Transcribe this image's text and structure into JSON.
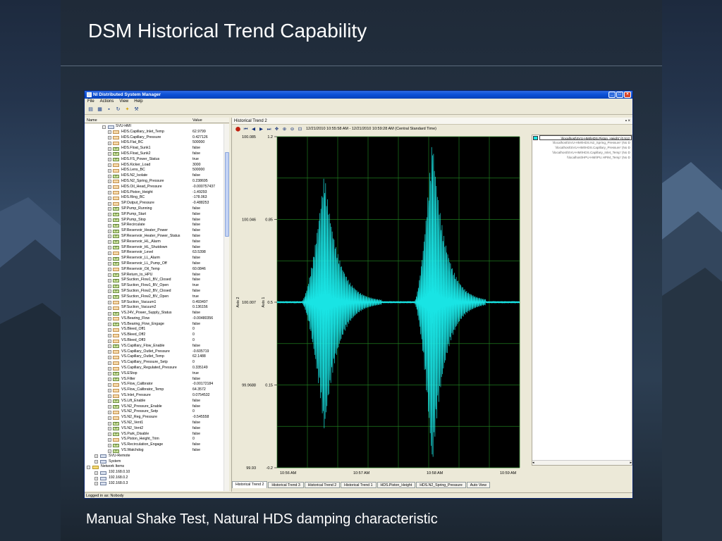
{
  "slide": {
    "title": "DSM Historical Trend Capability",
    "caption": "Manual Shake Test, Natural HDS damping characteristic"
  },
  "window": {
    "title": "NI Distributed System Manager",
    "menu": [
      "File",
      "Actions",
      "View",
      "Help"
    ],
    "toolbar_icons": [
      "new-icon",
      "open-icon",
      "save-icon",
      "refresh-icon",
      "star-icon",
      "wrench-icon"
    ],
    "columns": {
      "name": "Name",
      "value": "Value"
    },
    "status": "Logged in as: Nobody"
  },
  "tree": {
    "root": "SVU-HMI",
    "items": [
      {
        "name": "HDS.Capillary_Inlet_Temp",
        "value": "62.9799",
        "type": "num"
      },
      {
        "name": "HDS.Capillary_Pressure",
        "value": "0.427126",
        "type": "num"
      },
      {
        "name": "HDS.Flat_BC",
        "value": "500000",
        "type": "num"
      },
      {
        "name": "HDS.Float_Sunk1",
        "value": "false",
        "type": "bool"
      },
      {
        "name": "HDS.Float_Sunk2",
        "value": "false",
        "type": "bool"
      },
      {
        "name": "HDS.FS_Power_Status",
        "value": "true",
        "type": "bool"
      },
      {
        "name": "HDS.Kicker_Load",
        "value": "3000",
        "type": "num"
      },
      {
        "name": "HDS.Lens_BC",
        "value": "500000",
        "type": "num"
      },
      {
        "name": "HDS.N2_Isolate",
        "value": "false",
        "type": "bool"
      },
      {
        "name": "HDS.N2_Spring_Pressure",
        "value": "0.238695",
        "type": "num"
      },
      {
        "name": "HDS.Oil_Head_Pressure",
        "value": "-0.000757437",
        "type": "num"
      },
      {
        "name": "HDS.Piston_Height",
        "value": "-1.49293",
        "type": "num"
      },
      {
        "name": "HDS.Ring_BC",
        "value": "-178.063",
        "type": "num"
      },
      {
        "name": "SP.Output_Pressure",
        "value": "-0.488253",
        "type": "num"
      },
      {
        "name": "SP.Pump_Running",
        "value": "false",
        "type": "bool"
      },
      {
        "name": "SP.Pump_Start",
        "value": "false",
        "type": "bool"
      },
      {
        "name": "SP.Pump_Stop",
        "value": "false",
        "type": "bool"
      },
      {
        "name": "SP.Recirculate",
        "value": "false",
        "type": "bool"
      },
      {
        "name": "SP.Reservoir_Heater_Power",
        "value": "false",
        "type": "bool"
      },
      {
        "name": "SP.Reservoir_Heater_Power_Status",
        "value": "false",
        "type": "bool"
      },
      {
        "name": "SP.Reservoir_HL_Alarm",
        "value": "false",
        "type": "bool"
      },
      {
        "name": "SP.Reservoir_HL_Shutdown",
        "value": "false",
        "type": "bool"
      },
      {
        "name": "SP.Reservoir_Level",
        "value": "63.5398",
        "type": "num"
      },
      {
        "name": "SP.Reservoir_LL_Alarm",
        "value": "false",
        "type": "bool"
      },
      {
        "name": "SP.Reservoir_LL_Pump_Off",
        "value": "false",
        "type": "bool"
      },
      {
        "name": "SP.Reservoir_Oil_Temp",
        "value": "60.0846",
        "type": "num"
      },
      {
        "name": "SP.Return_to_HPU",
        "value": "false",
        "type": "bool"
      },
      {
        "name": "SP.Suction_Flow1_BV_Closed",
        "value": "false",
        "type": "bool"
      },
      {
        "name": "SP.Suction_Flow1_BV_Open",
        "value": "true",
        "type": "bool"
      },
      {
        "name": "SP.Suction_Flow2_BV_Closed",
        "value": "false",
        "type": "bool"
      },
      {
        "name": "SP.Suction_Flow2_BV_Open",
        "value": "true",
        "type": "bool"
      },
      {
        "name": "SP.Suction_Vacuum1",
        "value": "0.493497",
        "type": "num"
      },
      {
        "name": "SP.Suction_Vacuum2",
        "value": "0.136156",
        "type": "num"
      },
      {
        "name": "VS.24V_Power_Supply_Status",
        "value": "false",
        "type": "bool"
      },
      {
        "name": "VS.Bearing_Flow",
        "value": "-0.00480356",
        "type": "num"
      },
      {
        "name": "VS.Bearing_Flow_Engage",
        "value": "false",
        "type": "bool"
      },
      {
        "name": "VS.Bleed_Off1",
        "value": "0",
        "type": "num"
      },
      {
        "name": "VS.Bleed_Off2",
        "value": "0",
        "type": "num"
      },
      {
        "name": "VS.Bleed_Off3",
        "value": "0",
        "type": "num"
      },
      {
        "name": "VS.Capillary_Flow_Enable",
        "value": "false",
        "type": "bool"
      },
      {
        "name": "VS.Capillary_Outlet_Pressure",
        "value": "-0.605719",
        "type": "num"
      },
      {
        "name": "VS.Capillary_Outlet_Temp",
        "value": "62.1488",
        "type": "num"
      },
      {
        "name": "VS.Capillary_Pressure_Setp",
        "value": "0",
        "type": "num"
      },
      {
        "name": "VS.Capillary_Regulated_Pressure",
        "value": "0.335149",
        "type": "num"
      },
      {
        "name": "VS.EStop",
        "value": "true",
        "type": "bool"
      },
      {
        "name": "VS.Filter",
        "value": "false",
        "type": "bool"
      },
      {
        "name": "VS.Flow_Calibrator",
        "value": "-0.00172184",
        "type": "num"
      },
      {
        "name": "VS.Flow_Calibrator_Temp",
        "value": "64.3572",
        "type": "num"
      },
      {
        "name": "VS.Inlet_Pressure",
        "value": "0.0754532",
        "type": "num"
      },
      {
        "name": "VS.Lift_Enable",
        "value": "false",
        "type": "bool"
      },
      {
        "name": "VS.N2_Pressure_Enable",
        "value": "false",
        "type": "bool"
      },
      {
        "name": "VS.N2_Pressure_Setp",
        "value": "0",
        "type": "num"
      },
      {
        "name": "VS.N2_Reg_Pressure",
        "value": "-0.545558",
        "type": "num"
      },
      {
        "name": "VS.N2_Vent1",
        "value": "false",
        "type": "bool"
      },
      {
        "name": "VS.N2_Vent2",
        "value": "false",
        "type": "bool"
      },
      {
        "name": "VS.Park_Disable",
        "value": "false",
        "type": "bool"
      },
      {
        "name": "VS.Piston_Height_Trim",
        "value": "0",
        "type": "num"
      },
      {
        "name": "VS.Recirculation_Engage",
        "value": "false",
        "type": "bool"
      },
      {
        "name": "VS.Watchdog",
        "value": "false",
        "type": "bool"
      }
    ],
    "tail": [
      {
        "name": "SVU-Remote",
        "indent": 1,
        "kind": "pc"
      },
      {
        "name": "System",
        "indent": 1,
        "kind": "pc"
      },
      {
        "name": "Network Items",
        "indent": 0,
        "kind": "folder"
      },
      {
        "name": "192.168.0.10",
        "indent": 1,
        "kind": "pc"
      },
      {
        "name": "192.168.0.2",
        "indent": 1,
        "kind": "pc"
      },
      {
        "name": "192.168.0.3",
        "indent": 1,
        "kind": "pc"
      }
    ]
  },
  "trend": {
    "pane_title": "Historical Trend 2",
    "time_range": "12/21/2010 10:55:58 AM - 12/21/2010 10:59:28 AM (Central Standard Time)",
    "tool_icons": [
      "record-icon",
      "first-icon",
      "prev-icon",
      "play-icon",
      "last-icon",
      "pan-icon",
      "zoom-in-icon",
      "zoom-out-icon",
      "fit-icon"
    ],
    "legend": [
      "\\\\localhost\\SVU-HMI\\HDS.Piston_Height' (0.512",
      "\\\\localhost\\SVU-HMI\\HDS.N2_Spring_Pressure' (No D",
      "\\\\localhost\\SVU-HMI\\HDS.Capillary_Pressure' (No D",
      "\\\\localhost\\SVU-HMI\\HDS.Capillary_Inlet_Temp' (No D",
      "\\\\localhost\\HPU-HMI\\PU.HPIM_Temp' (No D"
    ],
    "tabs": [
      "Historical Trend 2",
      "Historical Trend 3",
      "Historical Trend 2",
      "Historical Trend 1",
      "HDS.Piston_Height",
      "HDS.N2_Spring_Pressure",
      "Auto View"
    ],
    "active_tab": 0
  },
  "chart_data": {
    "type": "line",
    "axis1_label": "Axis 1",
    "axis2_label": "Axis 2",
    "axis1_ticks": [
      "1.2",
      "0.85",
      "0.5",
      "0.15",
      "-0.2"
    ],
    "axis2_ticks": [
      "100.085",
      "100.046",
      "100.007",
      "99.9688",
      "99.93"
    ],
    "x_ticks": [
      "10:56 AM",
      "10:57 AM",
      "10:58 AM",
      "10:59 AM"
    ],
    "ylim": [
      -0.2,
      1.2
    ],
    "baseline": 0.5,
    "bursts": [
      {
        "start_fraction": 0.1,
        "peak_fraction": 0.195,
        "end_fraction": 0.43,
        "amplitude": 0.55
      },
      {
        "start_fraction": 0.565,
        "peak_fraction": 0.64,
        "end_fraction": 0.86,
        "amplitude": 0.7
      }
    ],
    "color": "#19e4e4",
    "grid": true
  }
}
